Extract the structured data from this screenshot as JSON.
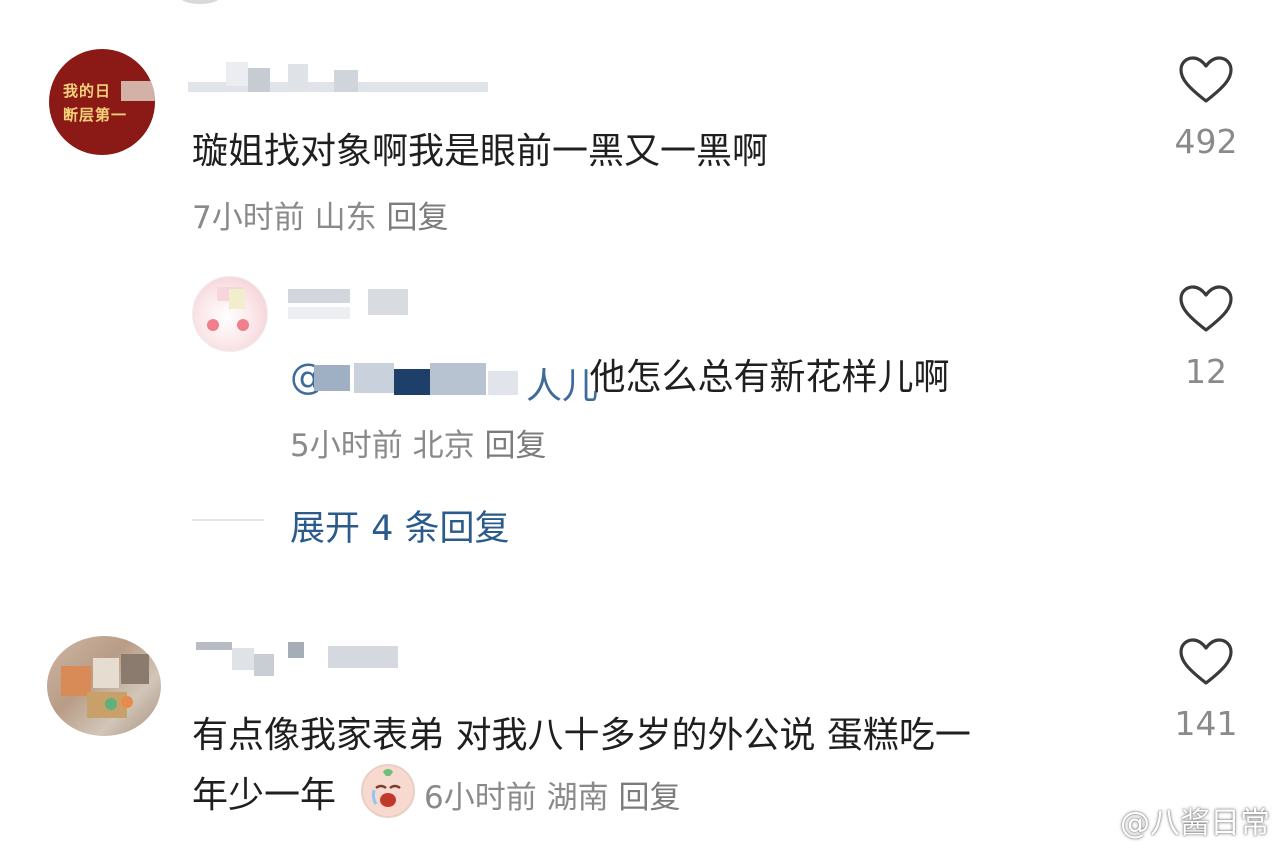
{
  "comments": [
    {
      "avatar_text_line1": "我的日",
      "avatar_text_line2": "断层第一",
      "text": "璇姐找对象啊我是眼前一黑又一黑啊",
      "time": "7小时前",
      "location": "山东",
      "reply_label": "回复",
      "likes": "492"
    },
    {
      "mention": "@",
      "mention_tail": "人儿",
      "text": "他怎么总有新花样儿啊",
      "time": "5小时前",
      "location": "北京",
      "reply_label": "回复",
      "likes": "12"
    },
    {
      "text_line1": "有点像我家表弟 对我八十多岁的外公说 蛋糕吃一",
      "text_line2": "年少一年",
      "time": "6小时前",
      "location": "湖南",
      "reply_label": "回复",
      "likes": "141"
    }
  ],
  "expand_replies": "展开 4 条回复",
  "watermark": "@八酱日常",
  "icons": {
    "like": "heart-outline-icon",
    "emoji": "crying-face-emoji-icon",
    "watermark_logo": "weibo-logo-icon"
  },
  "colors": {
    "text": "#1f1f1f",
    "meta": "#8a8a8a",
    "link": "#2b5b8b"
  }
}
